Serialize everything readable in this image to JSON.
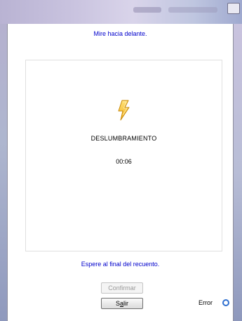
{
  "dialog": {
    "instruction": "Mire hacia delante.",
    "test_name": "DESLUMBRAMIENTO",
    "timer": "00:06",
    "wait_message": "Espere al final del recuento.",
    "confirm_label": "Confirmar",
    "exit_label_prefix": "S",
    "exit_label_underlined": "a",
    "exit_label_suffix": "lir",
    "confirm_enabled": false,
    "error_label": "Error",
    "error_indicator_color": "#2f6fd0",
    "icon": "lightning-bolt-icon",
    "accent_color": "#0000cc"
  }
}
